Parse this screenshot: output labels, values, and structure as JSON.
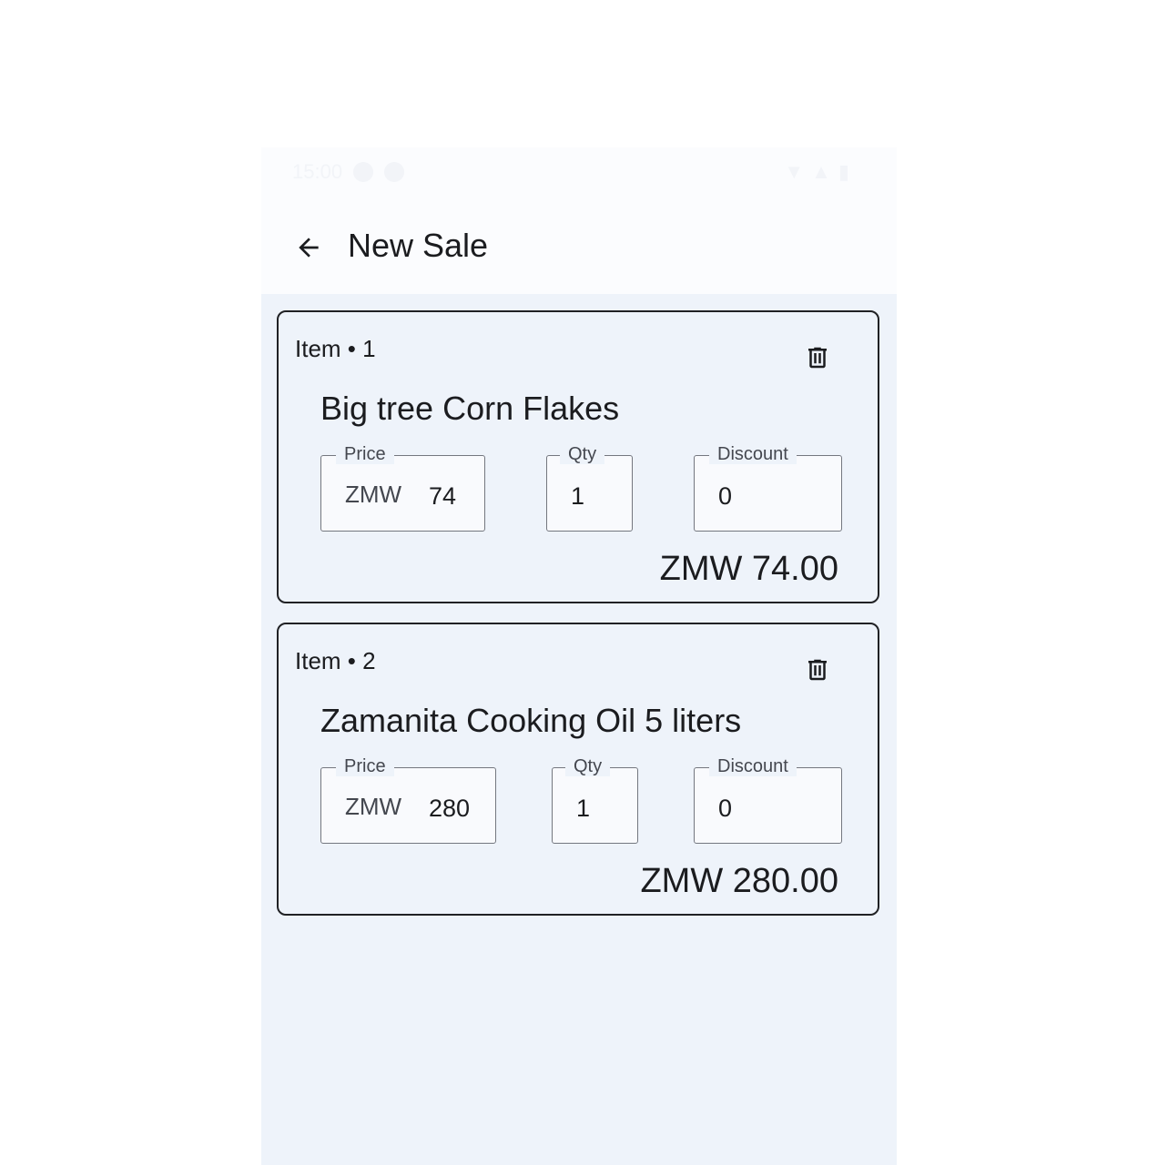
{
  "status_bar": {
    "time": "15:00"
  },
  "app_bar": {
    "back_icon": "arrow-left-icon",
    "title": "New Sale"
  },
  "items": [
    {
      "label": "Item • 1",
      "delete_icon": "trash-icon",
      "product": "Big tree Corn Flakes",
      "price_label": "Price",
      "price_prefix": "ZMW",
      "price_value": "74",
      "qty_label": "Qty",
      "qty_value": "1",
      "discount_label": "Discount",
      "discount_value": "0",
      "total": "ZMW 74.00"
    },
    {
      "label": "Item • 2",
      "delete_icon": "trash-icon",
      "product": "Zamanita Cooking Oil 5 liters",
      "price_label": "Price",
      "price_prefix": "ZMW",
      "price_value": "280",
      "qty_label": "Qty",
      "qty_value": "1",
      "discount_label": "Discount",
      "discount_value": "0",
      "total": "ZMW 280.00"
    }
  ]
}
